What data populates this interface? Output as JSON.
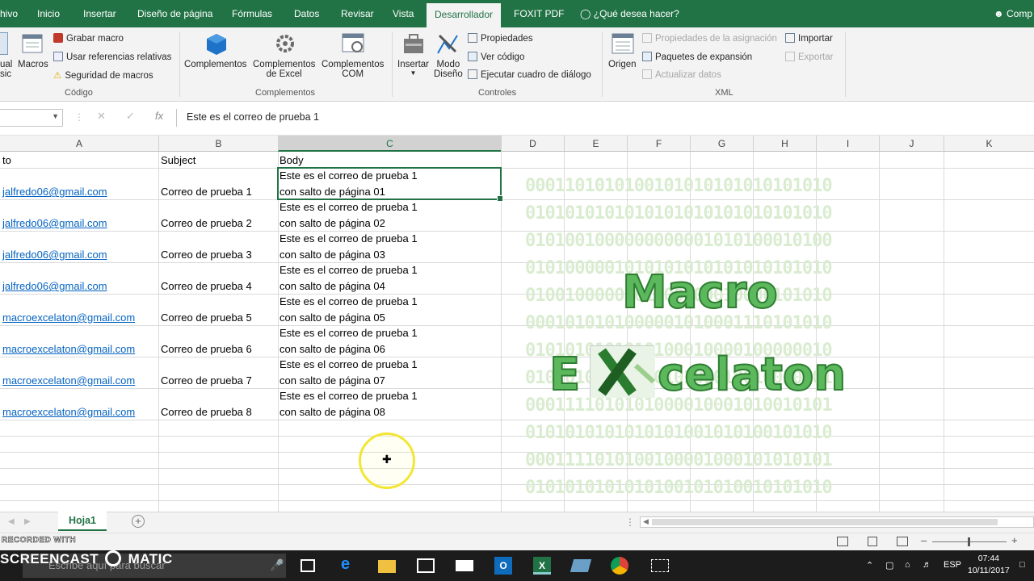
{
  "menu": {
    "tabs": [
      "hivo",
      "Inicio",
      "Insertar",
      "Diseño de página",
      "Fórmulas",
      "Datos",
      "Revisar",
      "Vista",
      "Desarrollador",
      "FOXIT PDF"
    ],
    "tell_me": "¿Qué desea hacer?",
    "account": "Comp"
  },
  "ribbon": {
    "codigo": {
      "visual_basic": [
        "ual",
        "sic"
      ],
      "macros": "Macros",
      "grabar_macro": "Grabar macro",
      "usar_referencias": "Usar referencias relativas",
      "seguridad": "Seguridad de macros",
      "label": "Código"
    },
    "complementos": {
      "complementos": "Complementos",
      "excel": [
        "Complementos",
        "de Excel"
      ],
      "com": [
        "Complementos",
        "COM"
      ],
      "label": "Complementos"
    },
    "controles": {
      "insertar": "Insertar",
      "modo": [
        "Modo",
        "Diseño"
      ],
      "propiedades": "Propiedades",
      "ver_codigo": "Ver código",
      "ejecutar": "Ejecutar cuadro de diálogo",
      "label": "Controles"
    },
    "xml": {
      "origen": "Origen",
      "prop_asignacion": "Propiedades de la asignación",
      "paquetes": "Paquetes de expansión",
      "actualizar": "Actualizar datos",
      "importar": "Importar",
      "exportar": "Exportar",
      "label": "XML"
    }
  },
  "formula_bar": {
    "fx": "fx",
    "content": "Este es el correo de prueba 1"
  },
  "columns": [
    "A",
    "B",
    "C",
    "D",
    "E",
    "F",
    "G",
    "H",
    "I",
    "J",
    "K"
  ],
  "sheet": {
    "headers": [
      "to",
      "Subject",
      "Body"
    ],
    "rows": [
      {
        "to": "jalfredo06@gmail.com",
        "subject": "Correo de prueba 1",
        "body1": "Este es el correo de prueba 1",
        "body2": "con salto de página 01"
      },
      {
        "to": "jalfredo06@gmail.com",
        "subject": "Correo de prueba 2",
        "body1": "Este es el correo de prueba 1",
        "body2": "con salto de página 02"
      },
      {
        "to": "jalfredo06@gmail.com",
        "subject": "Correo de prueba 3",
        "body1": "Este es el correo de prueba 1",
        "body2": "con salto de página 03"
      },
      {
        "to": "jalfredo06@gmail.com",
        "subject": "Correo de prueba 4",
        "body1": "Este es el correo de prueba 1",
        "body2": "con salto de página 04"
      },
      {
        "to": "macroexcelaton@gmail.com",
        "subject": "Correo de prueba 5",
        "body1": "Este es el correo de prueba 1",
        "body2": "con salto de página 05"
      },
      {
        "to": "macroexcelaton@gmail.com",
        "subject": "Correo de prueba 6",
        "body1": "Este es el correo de prueba 1",
        "body2": "con salto de página 06"
      },
      {
        "to": "macroexcelaton@gmail.com",
        "subject": "Correo de prueba 7",
        "body1": "Este es el correo de prueba 1",
        "body2": "con salto de página 07"
      },
      {
        "to": "macroexcelaton@gmail.com",
        "subject": "Correo de prueba 8",
        "body1": "Este es el correo de prueba 1",
        "body2": "con salto de página 08"
      }
    ]
  },
  "logo": {
    "line1": "Macro",
    "line2a": "E",
    "line2b": "celaton",
    "binary": [
      "0001101010100101010101010101010",
      "0101010101010101010101010101010",
      "0101001000000000001010100010100",
      "0101000001010101010101010101010",
      "0100100000101000100010000101010",
      "0001010101000001010001110101010",
      "0101010101010100010000100000010",
      "0101010001001010100010010010101",
      "0001111010101000010001010010101",
      "0101010101010101001010100101010",
      "0001111010100100001000101010101",
      "0101010101010100101010010101010"
    ]
  },
  "sheet_tab": "Hoja1",
  "watermark": {
    "small": "RECORDED WITH",
    "big_a": "SCREENCAST",
    "big_b": "MATIC"
  },
  "taskbar": {
    "search_placeholder": "Escribe aquí para buscar",
    "lang": "ESP",
    "time": "07:44",
    "date": "10/11/2017"
  },
  "colors": {
    "excel_green": "#217346",
    "link": "#0563c1",
    "logo_green": "#5cb85c"
  }
}
